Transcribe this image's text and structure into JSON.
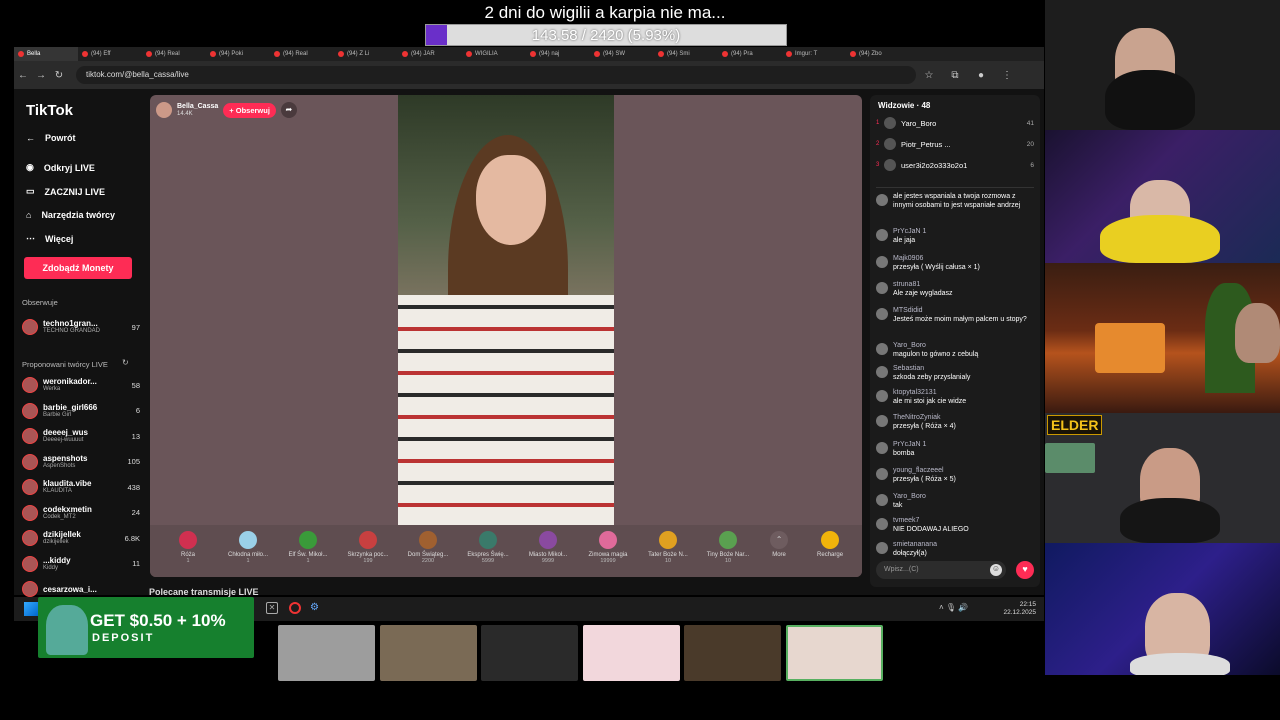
{
  "overlay": {
    "title": "2 dni do wigilii a karpia nie ma...",
    "goal_text": "143.58 / 2420 (5.93%)",
    "goal_progress": 0.0593,
    "goal_color": "#6a2fc9"
  },
  "browser": {
    "tabs": [
      "Bella",
      "(94) Eff",
      "(94) Real",
      "(94) Poki",
      "(94) Real",
      "(94) Z Li",
      "(94) JAR",
      "WIGILIA",
      "(94) naj",
      "(94) SW",
      "(94) Smi",
      "(94) Pra",
      "Imgur: T",
      "(94) Zbo"
    ],
    "url": "tiktok.com/@bella_cassa/live"
  },
  "sidebar": {
    "logo": "TikTok",
    "back": "Powrót",
    "nav": [
      "Odkryj LIVE",
      "ZACZNIJ LIVE",
      "Narzędzia twórcy",
      "Więcej"
    ],
    "money_button": "Zdobądź Monety",
    "following_header": "Obserwuje",
    "following": [
      {
        "name": "techno1gran...",
        "sub": "TECHNO GRANDAD",
        "count": "97"
      }
    ],
    "suggested_header": "Proponowani twórcy LIVE",
    "suggested": [
      {
        "name": "weronikador...",
        "sub": "Werka",
        "count": "58"
      },
      {
        "name": "barbie_girl666",
        "sub": "Barbie Girl",
        "count": "6"
      },
      {
        "name": "deeeej_wus",
        "sub": "Deeeej-wuuuut",
        "count": "13"
      },
      {
        "name": "aspenshots",
        "sub": "AspenShots",
        "count": "105"
      },
      {
        "name": "klaudita.vibe",
        "sub": "KLAUDITA",
        "count": "438"
      },
      {
        "name": "codekxmetin",
        "sub": "Codek_MT2",
        "count": "24"
      },
      {
        "name": "dzikijellek",
        "sub": "dzikijellek",
        "count": "6.8K"
      },
      {
        "name": "...kiddy",
        "sub": "Kiddy",
        "count": "11"
      },
      {
        "name": "cesarzowa_i...",
        "sub": "",
        "count": ""
      }
    ]
  },
  "live": {
    "streamer_name": "Bella_Cassa",
    "streamer_viewers": "14.4K",
    "follow_label": "+ Obserwuj",
    "gifts": [
      {
        "name": "Róża",
        "price": "1"
      },
      {
        "name": "Chłodna miło...",
        "price": "1"
      },
      {
        "name": "Elf Św. Mikoł...",
        "price": "1"
      },
      {
        "name": "Skrzynka poc...",
        "price": "199"
      },
      {
        "name": "Dom Świąteg...",
        "price": "2200"
      },
      {
        "name": "Ekspres Świę...",
        "price": "5999"
      },
      {
        "name": "Miasto Mikoł...",
        "price": "9999"
      },
      {
        "name": "Zimowa magia",
        "price": "19999"
      },
      {
        "name": "Tater Boże N...",
        "price": "10"
      },
      {
        "name": "Tiny Boże Nar...",
        "price": "10"
      }
    ],
    "more_label": "More",
    "recharge_label": "Recharge"
  },
  "chat": {
    "viewers_header": "Widzowie · 48",
    "top_viewers": [
      {
        "rank": "1",
        "name": "Yaro_Boro",
        "count": "41"
      },
      {
        "rank": "2",
        "name": "Piotr_Petrus ...",
        "count": "20"
      },
      {
        "rank": "3",
        "name": "user3i2o2o333o2o1",
        "count": "6"
      }
    ],
    "messages": [
      {
        "user": "",
        "text": "ale jestes wspaniala a twoja rozmowa z innymi osobami to jest wspaniałe andrzej"
      },
      {
        "user": "PrYcJaN 1",
        "text": "ale jaja"
      },
      {
        "user": "Majk0906",
        "text": "przesyła ( Wyślij całusa × 1)"
      },
      {
        "user": "struna81",
        "text": "Ale zaje wygladasz"
      },
      {
        "user": "MTSdidid",
        "text": "Jesteś może moim małym palcem u stopy?"
      },
      {
        "user": "Yaro_Boro",
        "text": "magulon to gówno z cebulą"
      },
      {
        "user": "Sebastian",
        "text": "szkoda zeby przyslanialy"
      },
      {
        "user": "ktopytal32131",
        "text": "ale mi stoi jak cie widze"
      },
      {
        "user": "TheNitroZyniak",
        "text": "przesyła ( Róża × 4)"
      },
      {
        "user": "PrYcJaN 1",
        "text": "bomba"
      },
      {
        "user": "young_flaczeeel",
        "text": "przesyła ( Róża × 5)"
      },
      {
        "user": "Yaro_Boro",
        "text": "tak"
      },
      {
        "user": "tvmeek7",
        "text": "NIE DODAWAJ ALIEGO"
      },
      {
        "user": "smietananana",
        "text": "dołączył(a)"
      }
    ],
    "input_placeholder": "Wpisz...(C)"
  },
  "below": {
    "recommended": "Polecane transmisje LIVE",
    "clock_time": "22:15",
    "clock_date": "22.12.2025"
  },
  "ad": {
    "amount": "GET $0.50 + 10%",
    "deposit": "DEPOSIT"
  },
  "cams": {
    "badge": "ELDER"
  }
}
